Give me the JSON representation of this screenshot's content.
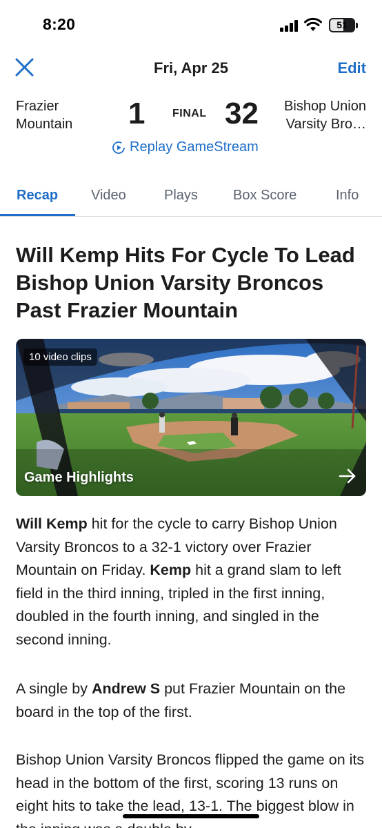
{
  "status_bar": {
    "time": "8:20",
    "battery_level": "51"
  },
  "header": {
    "date": "Fri, Apr 25",
    "edit_label": "Edit",
    "accent_color": "#1f6ec7"
  },
  "scoreboard": {
    "away_team": "Frazier Mountain",
    "away_score": "1",
    "status": "FINAL",
    "home_score": "32",
    "home_team_line1": "Bishop Union",
    "home_team_line2": "Varsity Bro…",
    "replay_label": "Replay GameStream"
  },
  "tabs": [
    {
      "label": "Recap",
      "active": true
    },
    {
      "label": "Video",
      "active": false
    },
    {
      "label": "Plays",
      "active": false
    },
    {
      "label": "Box Score",
      "active": false
    },
    {
      "label": "Info",
      "active": false
    }
  ],
  "article": {
    "headline": "Will Kemp Hits For Cycle To Lead Bishop Union Varsity Broncos Past Frazier Mountain",
    "video": {
      "clips_badge": "10 video clips",
      "title": "Game Highlights"
    },
    "p1": {
      "player": "Will Kemp",
      "text1": " hit for the cycle to carry Bishop Union Varsity Broncos to a 32-1 victory over Frazier Mountain on Friday. ",
      "player_short": "Kemp",
      "text2": " hit a grand slam to left field in the third inning, tripled in the first inning, doubled in the fourth inning, and singled in the second inning."
    },
    "p2": {
      "text1": "A single by ",
      "player": "Andrew S",
      "text2": " put Frazier Mountain on the board in the top of the first."
    },
    "p3": {
      "text": "Bishop Union Varsity Broncos flipped the game on its head in the bottom of the first, scoring 13 runs on eight hits to take the lead, 13-1. The biggest blow in the inning was a double by"
    }
  }
}
